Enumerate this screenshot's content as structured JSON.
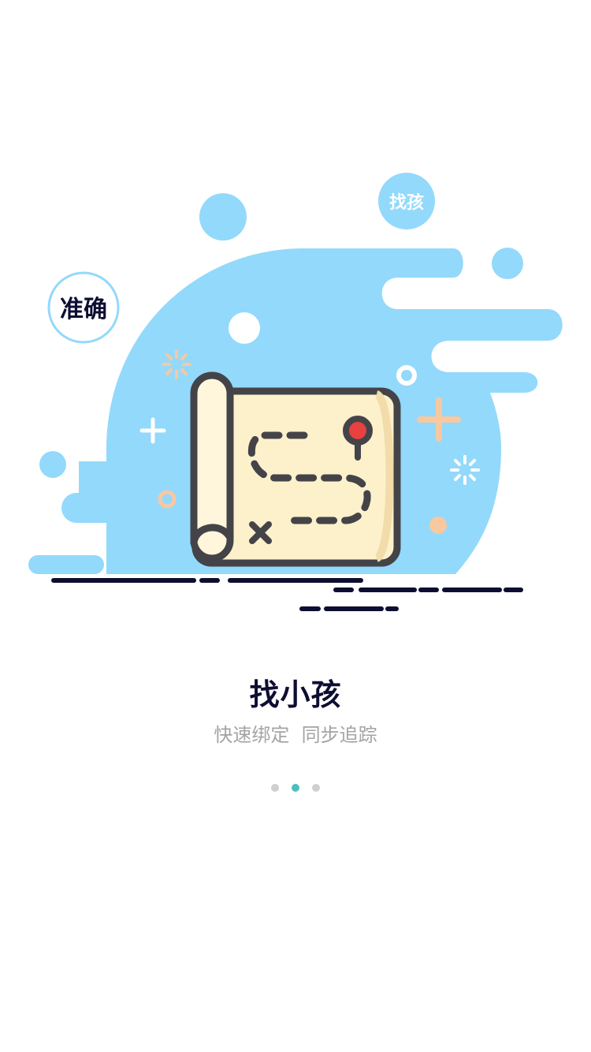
{
  "illustration": {
    "badge_left": "准确",
    "badge_top": "找孩",
    "icon": "treasure-map-icon"
  },
  "onboarding": {
    "title": "找小孩",
    "subtitle": "快速绑定  同步追踪"
  },
  "pager": {
    "total": 3,
    "active_index": 1
  },
  "colors": {
    "sky_blue": "#93d9fb",
    "navy": "#0e0e32",
    "map_paper": "#fdf1cc",
    "pin_red": "#e94040",
    "accent_orange": "#f8c8a0",
    "indicator_active": "#4bbfbf",
    "indicator_inactive": "#cfcfcf"
  }
}
